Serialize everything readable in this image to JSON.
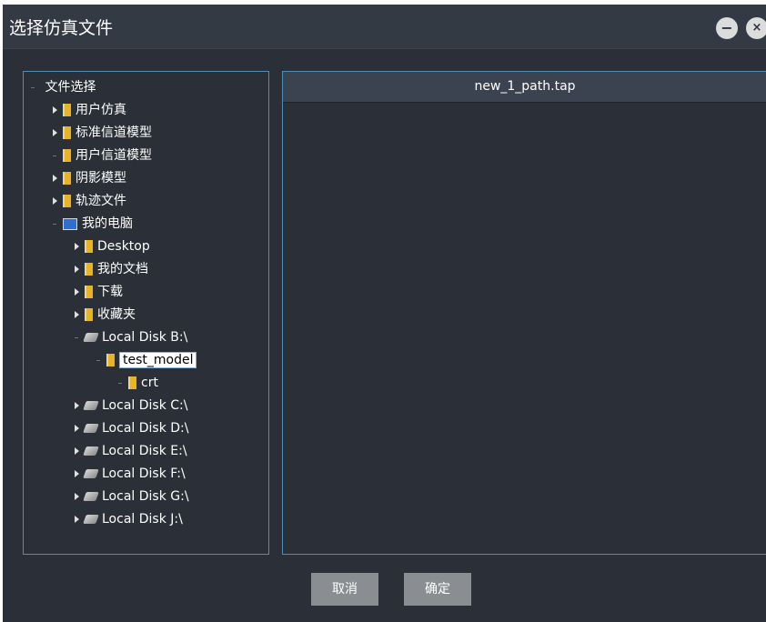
{
  "window": {
    "title": "选择仿真文件",
    "minimize_symbol": "−",
    "close_symbol": "×"
  },
  "tree": {
    "root_label": "文件选择",
    "items": [
      {
        "label": "用户仿真",
        "icon": "folder-icon",
        "expander": "collapsed"
      },
      {
        "label": "标准信道模型",
        "icon": "folder-icon",
        "expander": "collapsed"
      },
      {
        "label": "用户信道模型",
        "icon": "folder-icon",
        "expander": "none"
      },
      {
        "label": "阴影模型",
        "icon": "folder-icon",
        "expander": "collapsed"
      },
      {
        "label": "轨迹文件",
        "icon": "folder-icon",
        "expander": "collapsed"
      },
      {
        "label": "我的电脑",
        "icon": "computer-icon",
        "expander": "expanded"
      },
      {
        "label": "Desktop",
        "icon": "folder-icon",
        "expander": "collapsed"
      },
      {
        "label": "我的文档",
        "icon": "folder-icon",
        "expander": "collapsed"
      },
      {
        "label": "下载",
        "icon": "folder-icon",
        "expander": "collapsed"
      },
      {
        "label": "收藏夹",
        "icon": "folder-icon",
        "expander": "collapsed"
      },
      {
        "label": "Local Disk B:\\",
        "icon": "drive-icon",
        "expander": "expanded"
      },
      {
        "label": "test_model",
        "icon": "folder-icon",
        "expander": "expanded",
        "selected": true
      },
      {
        "label": "crt",
        "icon": "folder-icon",
        "expander": "none"
      },
      {
        "label": "Local Disk C:\\",
        "icon": "drive-icon",
        "expander": "collapsed"
      },
      {
        "label": "Local Disk D:\\",
        "icon": "drive-icon",
        "expander": "collapsed"
      },
      {
        "label": "Local Disk E:\\",
        "icon": "drive-icon",
        "expander": "collapsed"
      },
      {
        "label": "Local Disk F:\\",
        "icon": "drive-icon",
        "expander": "collapsed"
      },
      {
        "label": "Local Disk G:\\",
        "icon": "drive-icon",
        "expander": "collapsed"
      },
      {
        "label": "Local Disk J:\\",
        "icon": "drive-icon",
        "expander": "collapsed"
      }
    ]
  },
  "file_list": {
    "header": "new_1_path.tap"
  },
  "buttons": {
    "cancel_label": "取消",
    "ok_label": "确定"
  },
  "colors": {
    "dialog_bg": "#2b3038",
    "panel_border": "#4a8fb8",
    "button_bg": "#8a8d92",
    "folder": "#e8b426"
  }
}
